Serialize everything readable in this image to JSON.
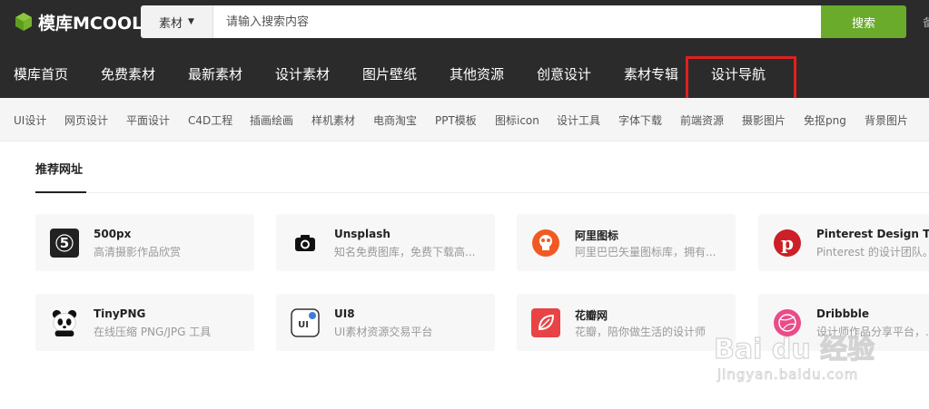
{
  "logo": {
    "text": "模库MCOOL"
  },
  "search": {
    "category": "素材",
    "placeholder": "请输入搜索内容",
    "button": "搜索"
  },
  "header_extra": "备",
  "main_nav": [
    "模库首页",
    "免费素材",
    "最新素材",
    "设计素材",
    "图片壁纸",
    "其他资源",
    "创意设计",
    "素材专辑",
    "设计导航"
  ],
  "sub_nav": [
    "UI设计",
    "网页设计",
    "平面设计",
    "C4D工程",
    "插画绘画",
    "样机素材",
    "电商淘宝",
    "PPT模板",
    "图标icon",
    "设计工具",
    "字体下载",
    "前端资源",
    "摄影图片",
    "免抠png",
    "背景图片"
  ],
  "section": {
    "tab": "推荐网址"
  },
  "cards": [
    {
      "title": "500px",
      "desc": "高清摄影作品欣赏",
      "icon": "500px-icon",
      "color": "#222222"
    },
    {
      "title": "Unsplash",
      "desc": "知名免费图库，免费下载高...",
      "icon": "camera-icon",
      "color": "#ffffff"
    },
    {
      "title": "阿里图标",
      "desc": "阿里巴巴矢量图标库，拥有...",
      "icon": "iconfont-icon",
      "color": "#f05a22"
    },
    {
      "title": "Pinterest Design Tea",
      "desc": "Pinterest 的设计团队。",
      "icon": "pinterest-icon",
      "color": "#cb2027"
    },
    {
      "title": "TinyPNG",
      "desc": "在线压缩 PNG/JPG 工具",
      "icon": "panda-icon",
      "color": "#ffffff"
    },
    {
      "title": "UI8",
      "desc": "UI素材资源交易平台",
      "icon": "ui8-icon",
      "color": "#ffffff"
    },
    {
      "title": "花瓣网",
      "desc": "花瓣，陪你做生活的设计师",
      "icon": "huaban-icon",
      "color": "#e94345"
    },
    {
      "title": "Dribbble",
      "desc": "设计师作品分享平台，...",
      "icon": "dribbble-icon",
      "color": "#ea4c89"
    }
  ],
  "watermark": {
    "text": "Bai du 经验",
    "sub": "jingyan.baidu.com"
  }
}
